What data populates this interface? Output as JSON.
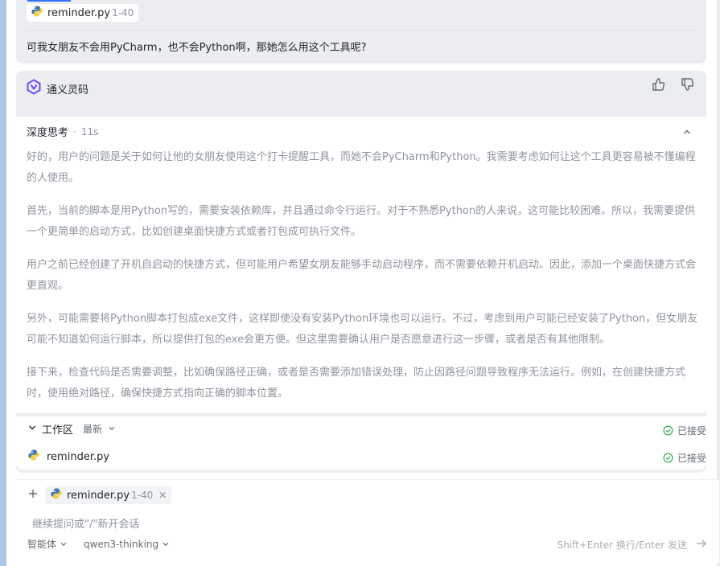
{
  "user_message": {
    "file": {
      "name": "reminder.py",
      "range": "1-40"
    },
    "question": "可我女朋友不会用PyCharm，也不会Python啊，那她怎么用这个工具呢?"
  },
  "assistant": {
    "name": "通义灵码",
    "thinking": {
      "title": "深度思考",
      "dot": "·",
      "time": "11s",
      "paragraphs": [
        "好的，用户的问题是关于如何让他的女朋友使用这个打卡提醒工具，而她不会PyCharm和Python。我需要考虑如何让这个工具更容易被不懂编程的人使用。",
        "首先，当前的脚本是用Python写的，需要安装依赖库，并且通过命令行运行。对于不熟悉Python的人来说，这可能比较困难。所以，我需要提供一个更简单的启动方式，比如创建桌面快捷方式或者打包成可执行文件。",
        "用户之前已经创建了开机自启动的快捷方式，但可能用户希望女朋友能够手动启动程序，而不需要依赖开机启动。因此，添加一个桌面快捷方式会更直观。",
        "另外，可能需要将Python脚本打包成exe文件，这样即使没有安装Python环境也可以运行。不过，考虑到用户可能已经安装了Python，但女朋友可能不知道如何运行脚本，所以提供打包的exe会更方便。但这里需要确认用户是否愿意进行这一步骤，或者是否有其他限制。",
        "接下来，检查代码是否需要调整，比如确保路径正确，或者是否需要添加错误处理，防止因路径问题导致程序无法运行。例如，在创建快捷方式时，使用绝对路径，确保快捷方式指向正确的脚本位置。"
      ]
    },
    "workspace": {
      "title": "工作区",
      "filter": "最新",
      "status_top": "已接受",
      "file": "reminder.py",
      "file_status": "已接受"
    }
  },
  "input": {
    "chip": {
      "name": "reminder.py",
      "range": "1-40"
    },
    "placeholder": "继续提问或\"/\"新开会话",
    "agent_mode": "智能体",
    "model": "qwen3-thinking",
    "hint": "Shift+Enter 换行/Enter 发送"
  },
  "colors": {
    "accent": "#3370ff",
    "accepted_green": "#34a853",
    "card_bg": "#ecedf0",
    "python_blue": "#3a75b0",
    "python_yellow": "#f7c93c",
    "logo_purple": "#6e4bff"
  },
  "icons": [
    "python-icon",
    "tongyi-logo-icon",
    "thumbs-up-icon",
    "thumbs-down-icon",
    "chevron-up-icon",
    "chevron-down-icon",
    "check-circle-icon",
    "plus-icon",
    "close-icon",
    "send-arrow-icon"
  ]
}
